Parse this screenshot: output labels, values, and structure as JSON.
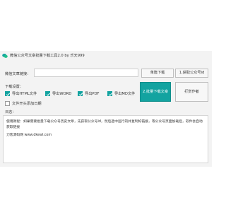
{
  "app": {
    "title": "微信公众号文章批量下载工具2.0 by 乐天999"
  },
  "url_row": {
    "label": "微信文章链接：",
    "input_value": "",
    "input_placeholder": "",
    "single_download_label": "单篇下载",
    "get_account_id_label": "1.获取公众号id"
  },
  "settings": {
    "label": "下载设置：",
    "options": [
      {
        "label": "导出HTML文件",
        "checked": true
      },
      {
        "label": "导出WORD",
        "checked": true
      },
      {
        "label": "导出PDF",
        "checked": true
      },
      {
        "label": "导出MD文件",
        "checked": true
      },
      {
        "label": "文件开头添加日期",
        "checked": false
      }
    ],
    "batch_download_label": "2.批量下载文章",
    "donate_label": "打赏作者"
  },
  "log": {
    "label": "日志：",
    "lines": [
      "使用教程：如果需要批量下载公众号历史文章，先获取公众号id，然后选中运行的并复制好链接，等公众号页面加载后，软件会自动获取链接",
      "刀客源码网 www.dkewl.com"
    ]
  },
  "colors": {
    "accent": "#13a3a0",
    "window_bg": "#f3f3f3"
  }
}
